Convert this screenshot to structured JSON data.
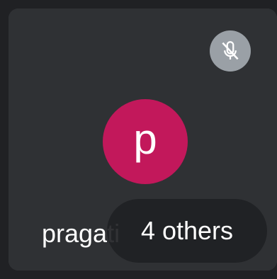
{
  "participant": {
    "initial": "p",
    "name": "pragati",
    "mic_status": "muted",
    "avatar_color": "#c2185b"
  },
  "overflow": {
    "label": "4 others"
  },
  "icons": {
    "mic": "mic-off-icon"
  },
  "colors": {
    "tile_background": "#2f3134",
    "page_background": "#202124",
    "mic_badge": "#9aa0a6"
  }
}
